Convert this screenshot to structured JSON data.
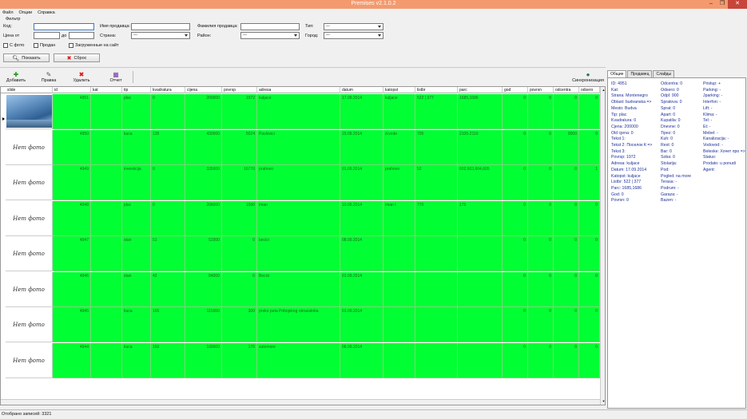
{
  "window": {
    "title": "Premises v2.1.0.2",
    "min": "–",
    "max": "❐",
    "close": "✕"
  },
  "menu": [
    "Файл",
    "Опции",
    "Справка"
  ],
  "filter": {
    "group_label": "Фильтр",
    "code_label": "Код:",
    "seller_name_label": "Имя продавца:",
    "seller_surname_label": "Фамилия продавца:",
    "type_label": "Тип:",
    "price_from_label": "Цена от",
    "price_to_label": "до",
    "country_label": "Страна:",
    "district_label": "Район:",
    "city_label": "Город:",
    "select_default": "---",
    "with_photo": "С фото",
    "sold": "Продан",
    "uploaded": "Загруженные на сайт",
    "show_button": "Показать",
    "reset_button": "Сброс"
  },
  "toolbar": {
    "add": "Добавить",
    "edit": "Правка",
    "delete": "Удалить",
    "report": "Отчет",
    "sync": "Синхронизация"
  },
  "grid": {
    "columns": [
      "slide",
      "id",
      "kat",
      "tip",
      "kvadratura",
      "cijena",
      "povrsp",
      "adresa",
      "datum",
      "katopst",
      "listbr",
      "parc",
      "god",
      "povrsn",
      "odcentra",
      "odsero"
    ],
    "no_photo": "Нет фото",
    "rows": [
      {
        "id": "4951",
        "kat": "",
        "tip": "plac",
        "kvadratura": "0",
        "cijena": "200000",
        "povrsp": "1972",
        "adresa": "kuljace",
        "datum": "17.09.2014",
        "katopst": "kuljace",
        "listbr": "522 | 377",
        "parc": "1685,1686",
        "god": "0",
        "povrsn": "0",
        "odcentra": "0",
        "odsero": "0",
        "has_photo": true
      },
      {
        "id": "4950",
        "kat": "",
        "tip": "kuca",
        "kvadratura": "135",
        "cijena": "430000",
        "povrsp": "5024",
        "adresa": "Pavlovici",
        "datum": "15.09.2014",
        "katopst": "d.vode",
        "listbr": "705",
        "parc": "2105-2110",
        "god": "0",
        "povrsn": "0",
        "odcentra": "9000",
        "odsero": "0",
        "has_photo": false
      },
      {
        "id": "4949",
        "kat": "",
        "tip": "investicija",
        "kvadratura": "0",
        "cijena": "335000",
        "povrsp": "16770",
        "adresa": "prahovo",
        "datum": "01.09.2014",
        "katopst": "prahovo",
        "listbr": "52",
        "parc": "602,603,604,605",
        "god": "0",
        "povrsn": "0",
        "odcentra": "0",
        "odsero": "1",
        "has_photo": false
      },
      {
        "id": "4948",
        "kat": "",
        "tip": "plac",
        "kvadratura": "0",
        "cijena": "208000",
        "povrsp": "1588",
        "adresa": "iman",
        "datum": "10.09.2014",
        "katopst": "iman I",
        "listbr": "770",
        "parc": "175",
        "god": "0",
        "povrsn": "0",
        "odcentra": "0",
        "odsero": "0",
        "has_photo": false
      },
      {
        "id": "4947",
        "kat": "",
        "tip": "stan",
        "kvadratura": "51",
        "cijena": "52000",
        "povrsp": "0",
        "adresa": "becici",
        "datum": "08.09.2014",
        "katopst": "",
        "listbr": "",
        "parc": "",
        "god": "0",
        "povrsn": "0",
        "odcentra": "0",
        "odsero": "0",
        "has_photo": false
      },
      {
        "id": "4946",
        "kat": "",
        "tip": "stan",
        "kvadratura": "42",
        "cijena": "84000",
        "povrsp": "0",
        "adresa": "Becici",
        "datum": "01.09.2014",
        "katopst": "",
        "listbr": "",
        "parc": "",
        "god": "0",
        "povrsn": "0",
        "odcentra": "0",
        "odsero": "0",
        "has_photo": false
      },
      {
        "id": "4945",
        "kat": "",
        "tip": "kuca",
        "kvadratura": "165",
        "cijena": "115000",
        "povrsp": "300",
        "adresa": "preko puta Pribojskog obrazaloba",
        "datum": "01.09.2014",
        "katopst": "",
        "listbr": "",
        "parc": "",
        "god": "0",
        "povrsn": "0",
        "odcentra": "0",
        "odsero": "0",
        "has_photo": false
      },
      {
        "id": "4944",
        "kat": "",
        "tip": "kuca",
        "kvadratura": "150",
        "cijena": "109000",
        "povrsp": "176",
        "adresa": "sutomore",
        "datum": "08.09.2014",
        "katopst": "",
        "listbr": "",
        "parc": "",
        "god": "0",
        "povrsn": "0",
        "odcentra": "0",
        "odsero": "0",
        "has_photo": false
      }
    ]
  },
  "panel": {
    "tabs": [
      "Общие",
      "Продавец",
      "Слайды"
    ],
    "col1": [
      "ID: 4951",
      "Kat:",
      "Strana: Montenegro",
      "Oblast: budvanska =>",
      "Mesto: Budva",
      "Tip: plac",
      "Kvadratura: 0",
      "Cjena: 200000",
      "Old cjena: 0",
      "Tekst 1:",
      "Tekst 2: Поселок К =>",
      "Tekst 3:",
      "Povrsp: 1972",
      "Adresa: kuljace",
      "Datum: 17.09.2014",
      "Katopst: kuljace",
      "Listbr: 522 | 377",
      "Parc: 1685,1686",
      "God: 0",
      "Povrsn: 0"
    ],
    "col2": [
      "Odcentra: 0",
      "Odsero: 0",
      "Odpl: 900",
      "Spratova: 0",
      "Sprat: 0",
      "Apart: 0",
      "Kupatila: 0",
      "Dnevne: 0",
      "Tipez: 0",
      "Kuh: 0",
      "Rest: 0",
      "Bar: 0",
      "Soba: 0",
      "Stolarija:",
      "Pod:",
      "Pogled: na more",
      "Terasa: -",
      "Podrum: -",
      "Garaza: -",
      "Bazen: -"
    ],
    "col3": [
      "Pristup: +",
      "Parking: -",
      "Jparking: -",
      "Interfon: -",
      "Lift: -",
      "Klima: -",
      "Tel: -",
      "Et: -",
      "Mebel: -",
      "Kanalizacija: -",
      "Vodovod: -",
      "Beleske: Хочет про =>",
      "Status:",
      "Prodato: u ponudi",
      "Agent:"
    ]
  },
  "status": {
    "text": "Отобрано записей: 3321"
  }
}
